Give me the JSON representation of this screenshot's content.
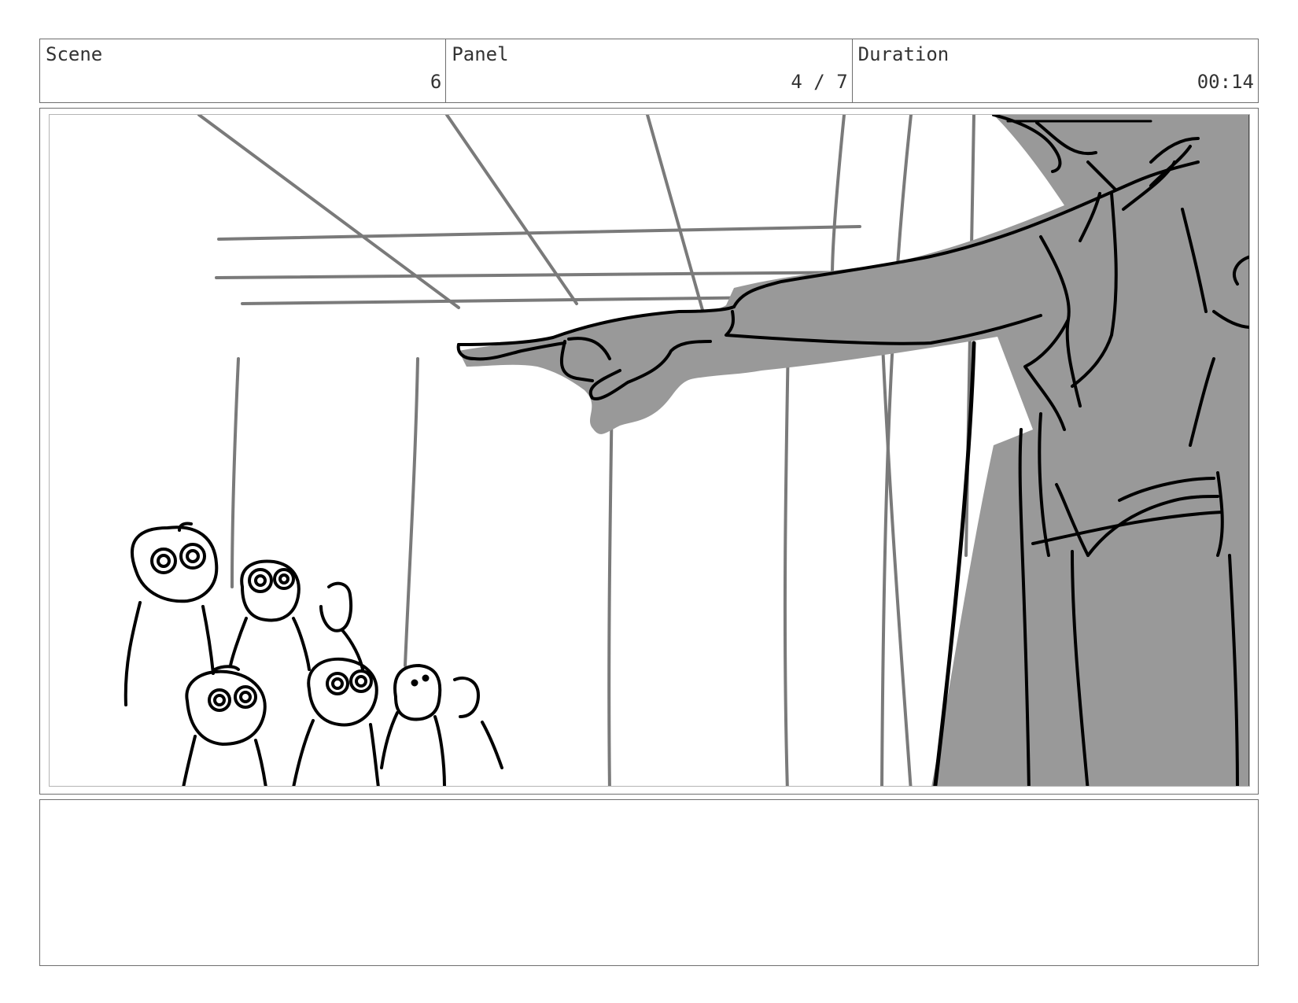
{
  "header": {
    "scene": {
      "label": "Scene",
      "value": "6"
    },
    "panel": {
      "label": "Panel",
      "value": "4 / 7"
    },
    "duration": {
      "label": "Duration",
      "value": "00:14"
    }
  },
  "drawing": {
    "description_colors": {
      "line_dark": "#000000",
      "line_gray": "#7a7a7a",
      "fill_gray": "#999999"
    }
  },
  "notes": {
    "text": ""
  }
}
